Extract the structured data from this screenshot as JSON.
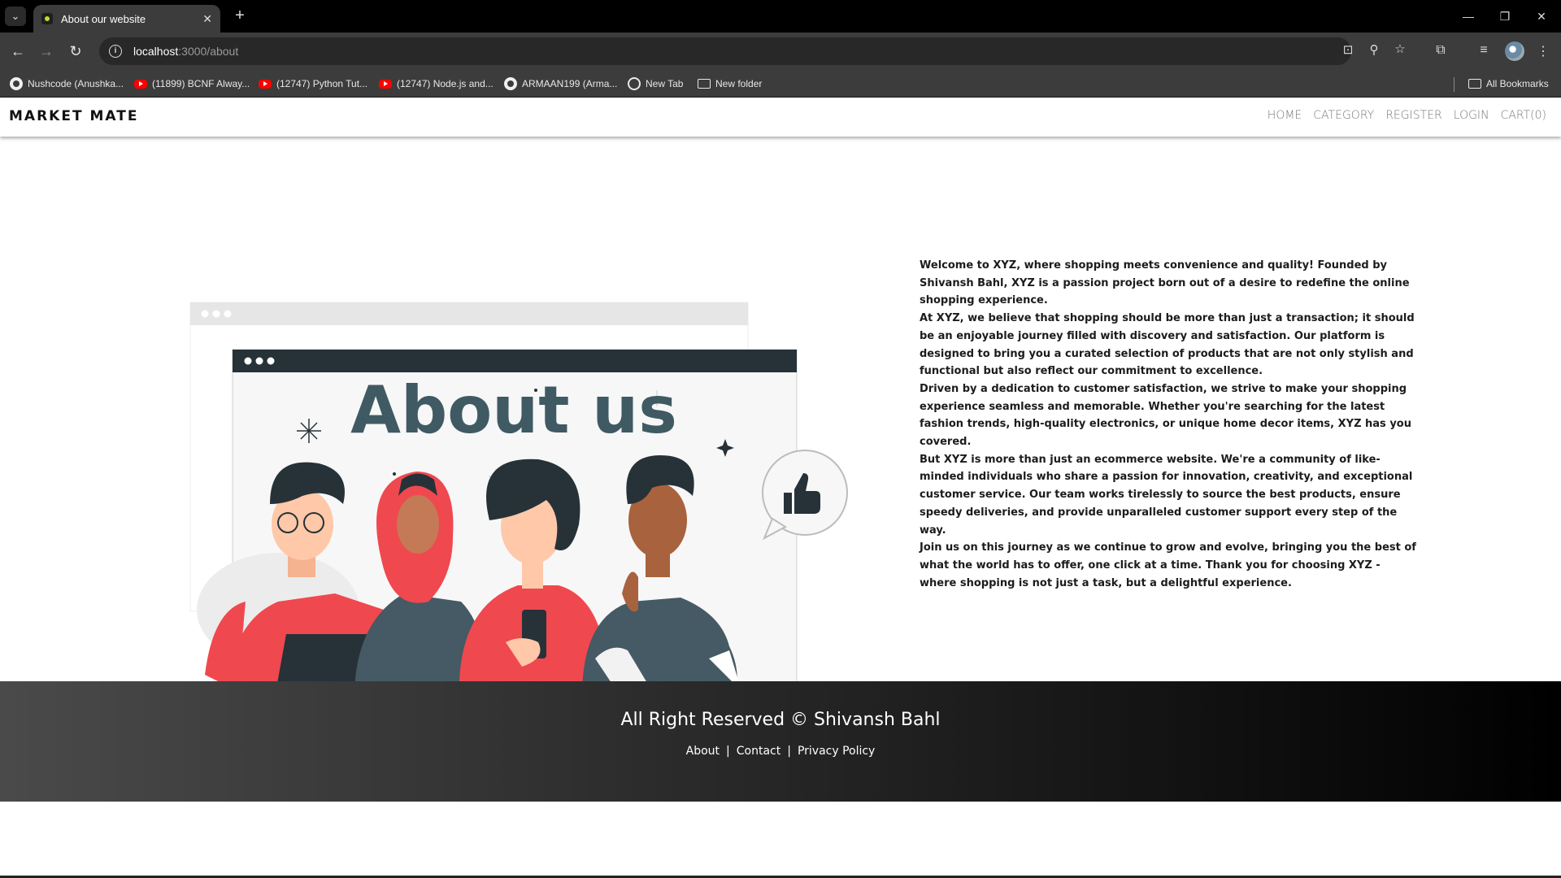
{
  "browser": {
    "tab_title": "About our website",
    "url_host": "localhost",
    "url_path": ":3000/about",
    "bookmarks": [
      {
        "label": "Nushcode (Anushka...",
        "icon": "github-icon"
      },
      {
        "label": "(11899) BCNF Alway...",
        "icon": "youtube-icon"
      },
      {
        "label": "(12747) Python Tut...",
        "icon": "youtube-icon"
      },
      {
        "label": "(12747) Node.js and...",
        "icon": "youtube-icon"
      },
      {
        "label": "ARMAAN199 (Arma...",
        "icon": "github-icon"
      },
      {
        "label": "New Tab",
        "icon": "globe-icon"
      },
      {
        "label": "New folder",
        "icon": "folder-icon"
      }
    ],
    "all_bookmarks": "All Bookmarks"
  },
  "navbar": {
    "brand": "MARKET MATE",
    "links": [
      "HOME",
      "CATEGORY",
      "REGISTER",
      "LOGIN",
      "CART(0)"
    ]
  },
  "about": {
    "paragraphs": [
      "Welcome to XYZ, where shopping meets convenience and quality! Founded by Shivansh Bahl, XYZ is a passion project born out of a desire to redefine the online shopping experience.",
      "At XYZ, we believe that shopping should be more than just a transaction; it should be an enjoyable journey filled with discovery and satisfaction. Our platform is designed to bring you a curated selection of products that are not only stylish and functional but also reflect our commitment to excellence.",
      "Driven by a dedication to customer satisfaction, we strive to make your shopping experience seamless and memorable. Whether you're searching for the latest fashion trends, high-quality electronics, or unique home decor items, XYZ has you covered.",
      "But XYZ is more than just an ecommerce website. We're a community of like-minded individuals who share a passion for innovation, creativity, and exceptional customer service. Our team works tirelessly to source the best products, ensure speedy deliveries, and provide unparalleled customer support every step of the way.",
      "Join us on this journey as we continue to grow and evolve, bringing you the best of what the world has to offer, one click at a time. Thank you for choosing XYZ - where shopping is not just a task, but a delightful experience."
    ],
    "illustration_title": "About us"
  },
  "footer": {
    "title": "All Right Reserved © Shivansh Bahl",
    "links": [
      "About",
      "Contact",
      "Privacy Policy"
    ],
    "separator": "|"
  },
  "colors": {
    "coral": "#f0484f",
    "dark_teal": "#263238",
    "slate": "#455a64"
  }
}
